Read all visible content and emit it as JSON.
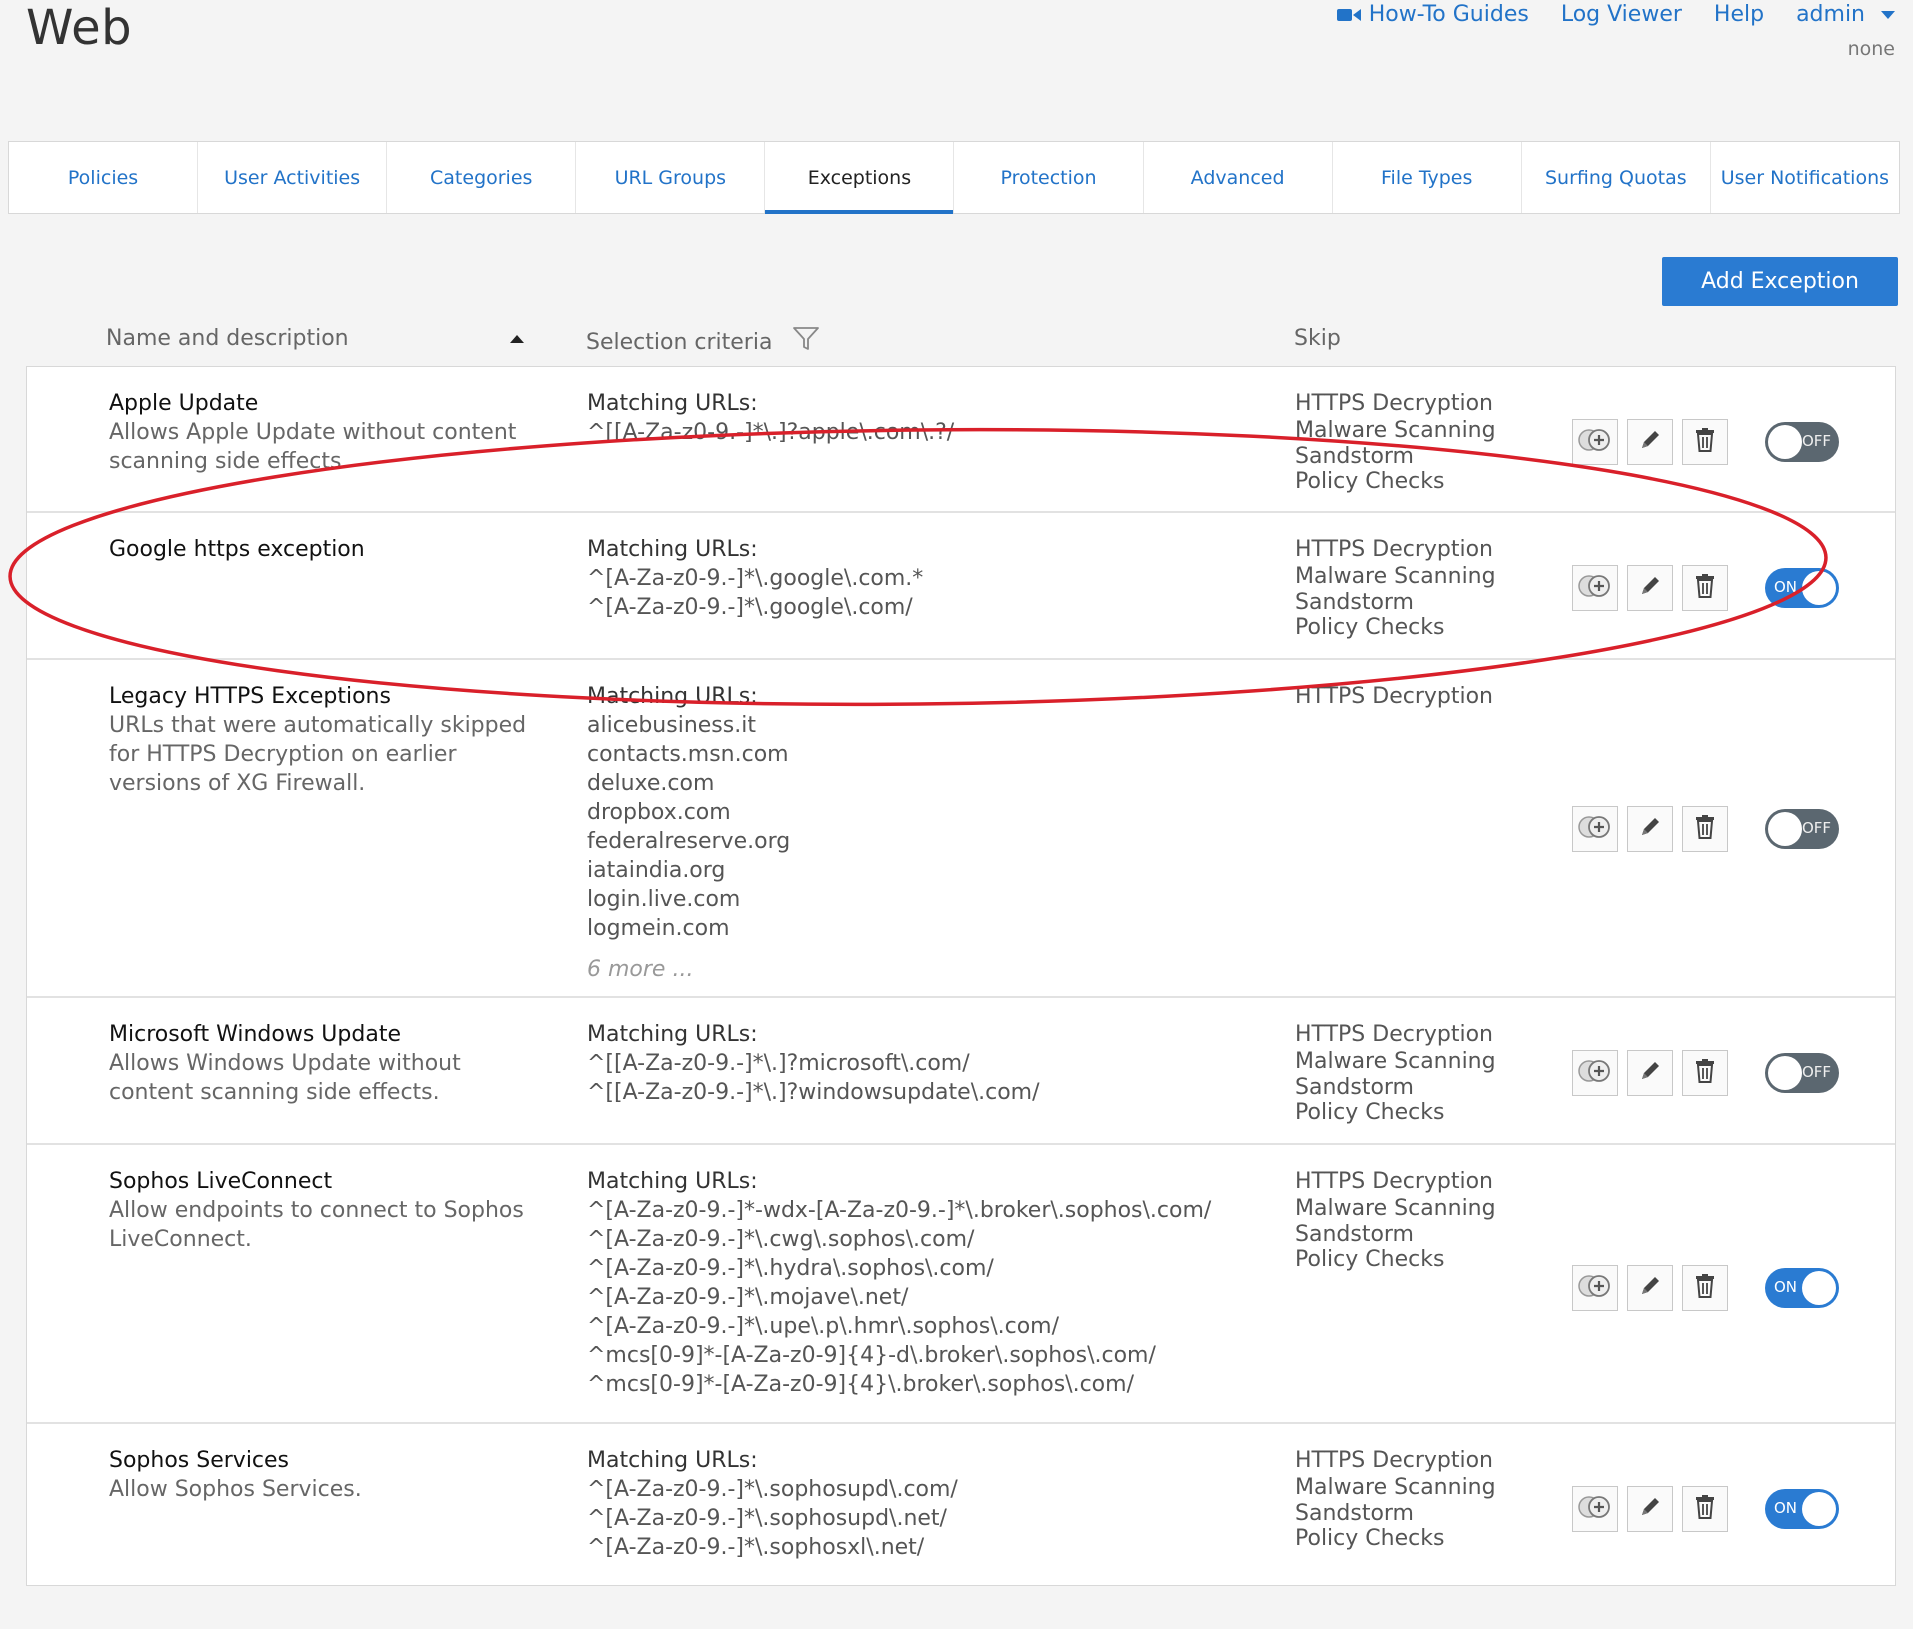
{
  "page": {
    "title": "Web"
  },
  "topnav": {
    "howto": "How-To Guides",
    "logviewer": "Log Viewer",
    "help": "Help",
    "user": "admin",
    "user_sub": "none"
  },
  "tabs": [
    "Policies",
    "User Activities",
    "Categories",
    "URL Groups",
    "Exceptions",
    "Protection",
    "Advanced",
    "File Types",
    "Surfing Quotas",
    "User Notifications"
  ],
  "active_tab": "Exceptions",
  "add_button": "Add Exception",
  "columns": {
    "name": "Name and description",
    "criteria": "Selection criteria",
    "skip": "Skip"
  },
  "rows": [
    {
      "name": "Apple Update",
      "desc": "Allows Apple Update without content scanning side effects.",
      "criteria_label": "Matching URLs:",
      "urls": [
        "^[[A-Za-z0-9.-]*\\.]?apple\\.com\\.?/"
      ],
      "skip": [
        "HTTPS Decryption",
        "Malware Scanning",
        "Sandstorm",
        "Policy Checks"
      ],
      "enabled": false,
      "toggle_label": "OFF"
    },
    {
      "name": "Google https exception",
      "desc": "",
      "criteria_label": "Matching URLs:",
      "urls": [
        "^[A-Za-z0-9.-]*\\.google\\.com.*",
        "^[A-Za-z0-9.-]*\\.google\\.com/"
      ],
      "skip": [
        "HTTPS Decryption",
        "Malware Scanning",
        "Sandstorm",
        "Policy Checks"
      ],
      "enabled": true,
      "toggle_label": "ON"
    },
    {
      "name": "Legacy HTTPS Exceptions",
      "desc": "URLs that were automatically skipped for HTTPS Decryption on earlier versions of XG Firewall.",
      "criteria_label": "Matching URLs:",
      "urls": [
        "alicebusiness.it",
        "contacts.msn.com",
        "deluxe.com",
        "dropbox.com",
        "federalreserve.org",
        "iataindia.org",
        "login.live.com",
        "logmein.com"
      ],
      "more": "6 more ...",
      "skip": [
        "HTTPS Decryption"
      ],
      "enabled": false,
      "toggle_label": "OFF"
    },
    {
      "name": "Microsoft Windows Update",
      "desc": "Allows Windows Update without content scanning side effects.",
      "criteria_label": "Matching URLs:",
      "urls": [
        "^[[A-Za-z0-9.-]*\\.]?microsoft\\.com/",
        "^[[A-Za-z0-9.-]*\\.]?windowsupdate\\.com/"
      ],
      "skip": [
        "HTTPS Decryption",
        "Malware Scanning",
        "Sandstorm",
        "Policy Checks"
      ],
      "enabled": false,
      "toggle_label": "OFF"
    },
    {
      "name": "Sophos LiveConnect",
      "desc": "Allow endpoints to connect to Sophos LiveConnect.",
      "criteria_label": "Matching URLs:",
      "urls": [
        "^[A-Za-z0-9.-]*-wdx-[A-Za-z0-9.-]*\\.broker\\.sophos\\.com/",
        "^[A-Za-z0-9.-]*\\.cwg\\.sophos\\.com/",
        "^[A-Za-z0-9.-]*\\.hydra\\.sophos\\.com/",
        "^[A-Za-z0-9.-]*\\.mojave\\.net/",
        "^[A-Za-z0-9.-]*\\.upe\\.p\\.hmr\\.sophos\\.com/",
        "^mcs[0-9]*-[A-Za-z0-9]{4}-d\\.broker\\.sophos\\.com/",
        "^mcs[0-9]*-[A-Za-z0-9]{4}\\.broker\\.sophos\\.com/"
      ],
      "skip": [
        "HTTPS Decryption",
        "Malware Scanning",
        "Sandstorm",
        "Policy Checks"
      ],
      "enabled": true,
      "toggle_label": "ON"
    },
    {
      "name": "Sophos Services",
      "desc": "Allow Sophos Services.",
      "criteria_label": "Matching URLs:",
      "urls": [
        "^[A-Za-z0-9.-]*\\.sophosupd\\.com/",
        "^[A-Za-z0-9.-]*\\.sophosupd\\.net/",
        "^[A-Za-z0-9.-]*\\.sophosxl\\.net/"
      ],
      "skip": [
        "HTTPS Decryption",
        "Malware Scanning",
        "Sandstorm",
        "Policy Checks"
      ],
      "enabled": true,
      "toggle_label": "ON"
    }
  ],
  "colors": {
    "accent": "#2a7bd2",
    "link": "#2273c8",
    "toggle_off": "#5b6770",
    "annotation": "#d9202a"
  }
}
